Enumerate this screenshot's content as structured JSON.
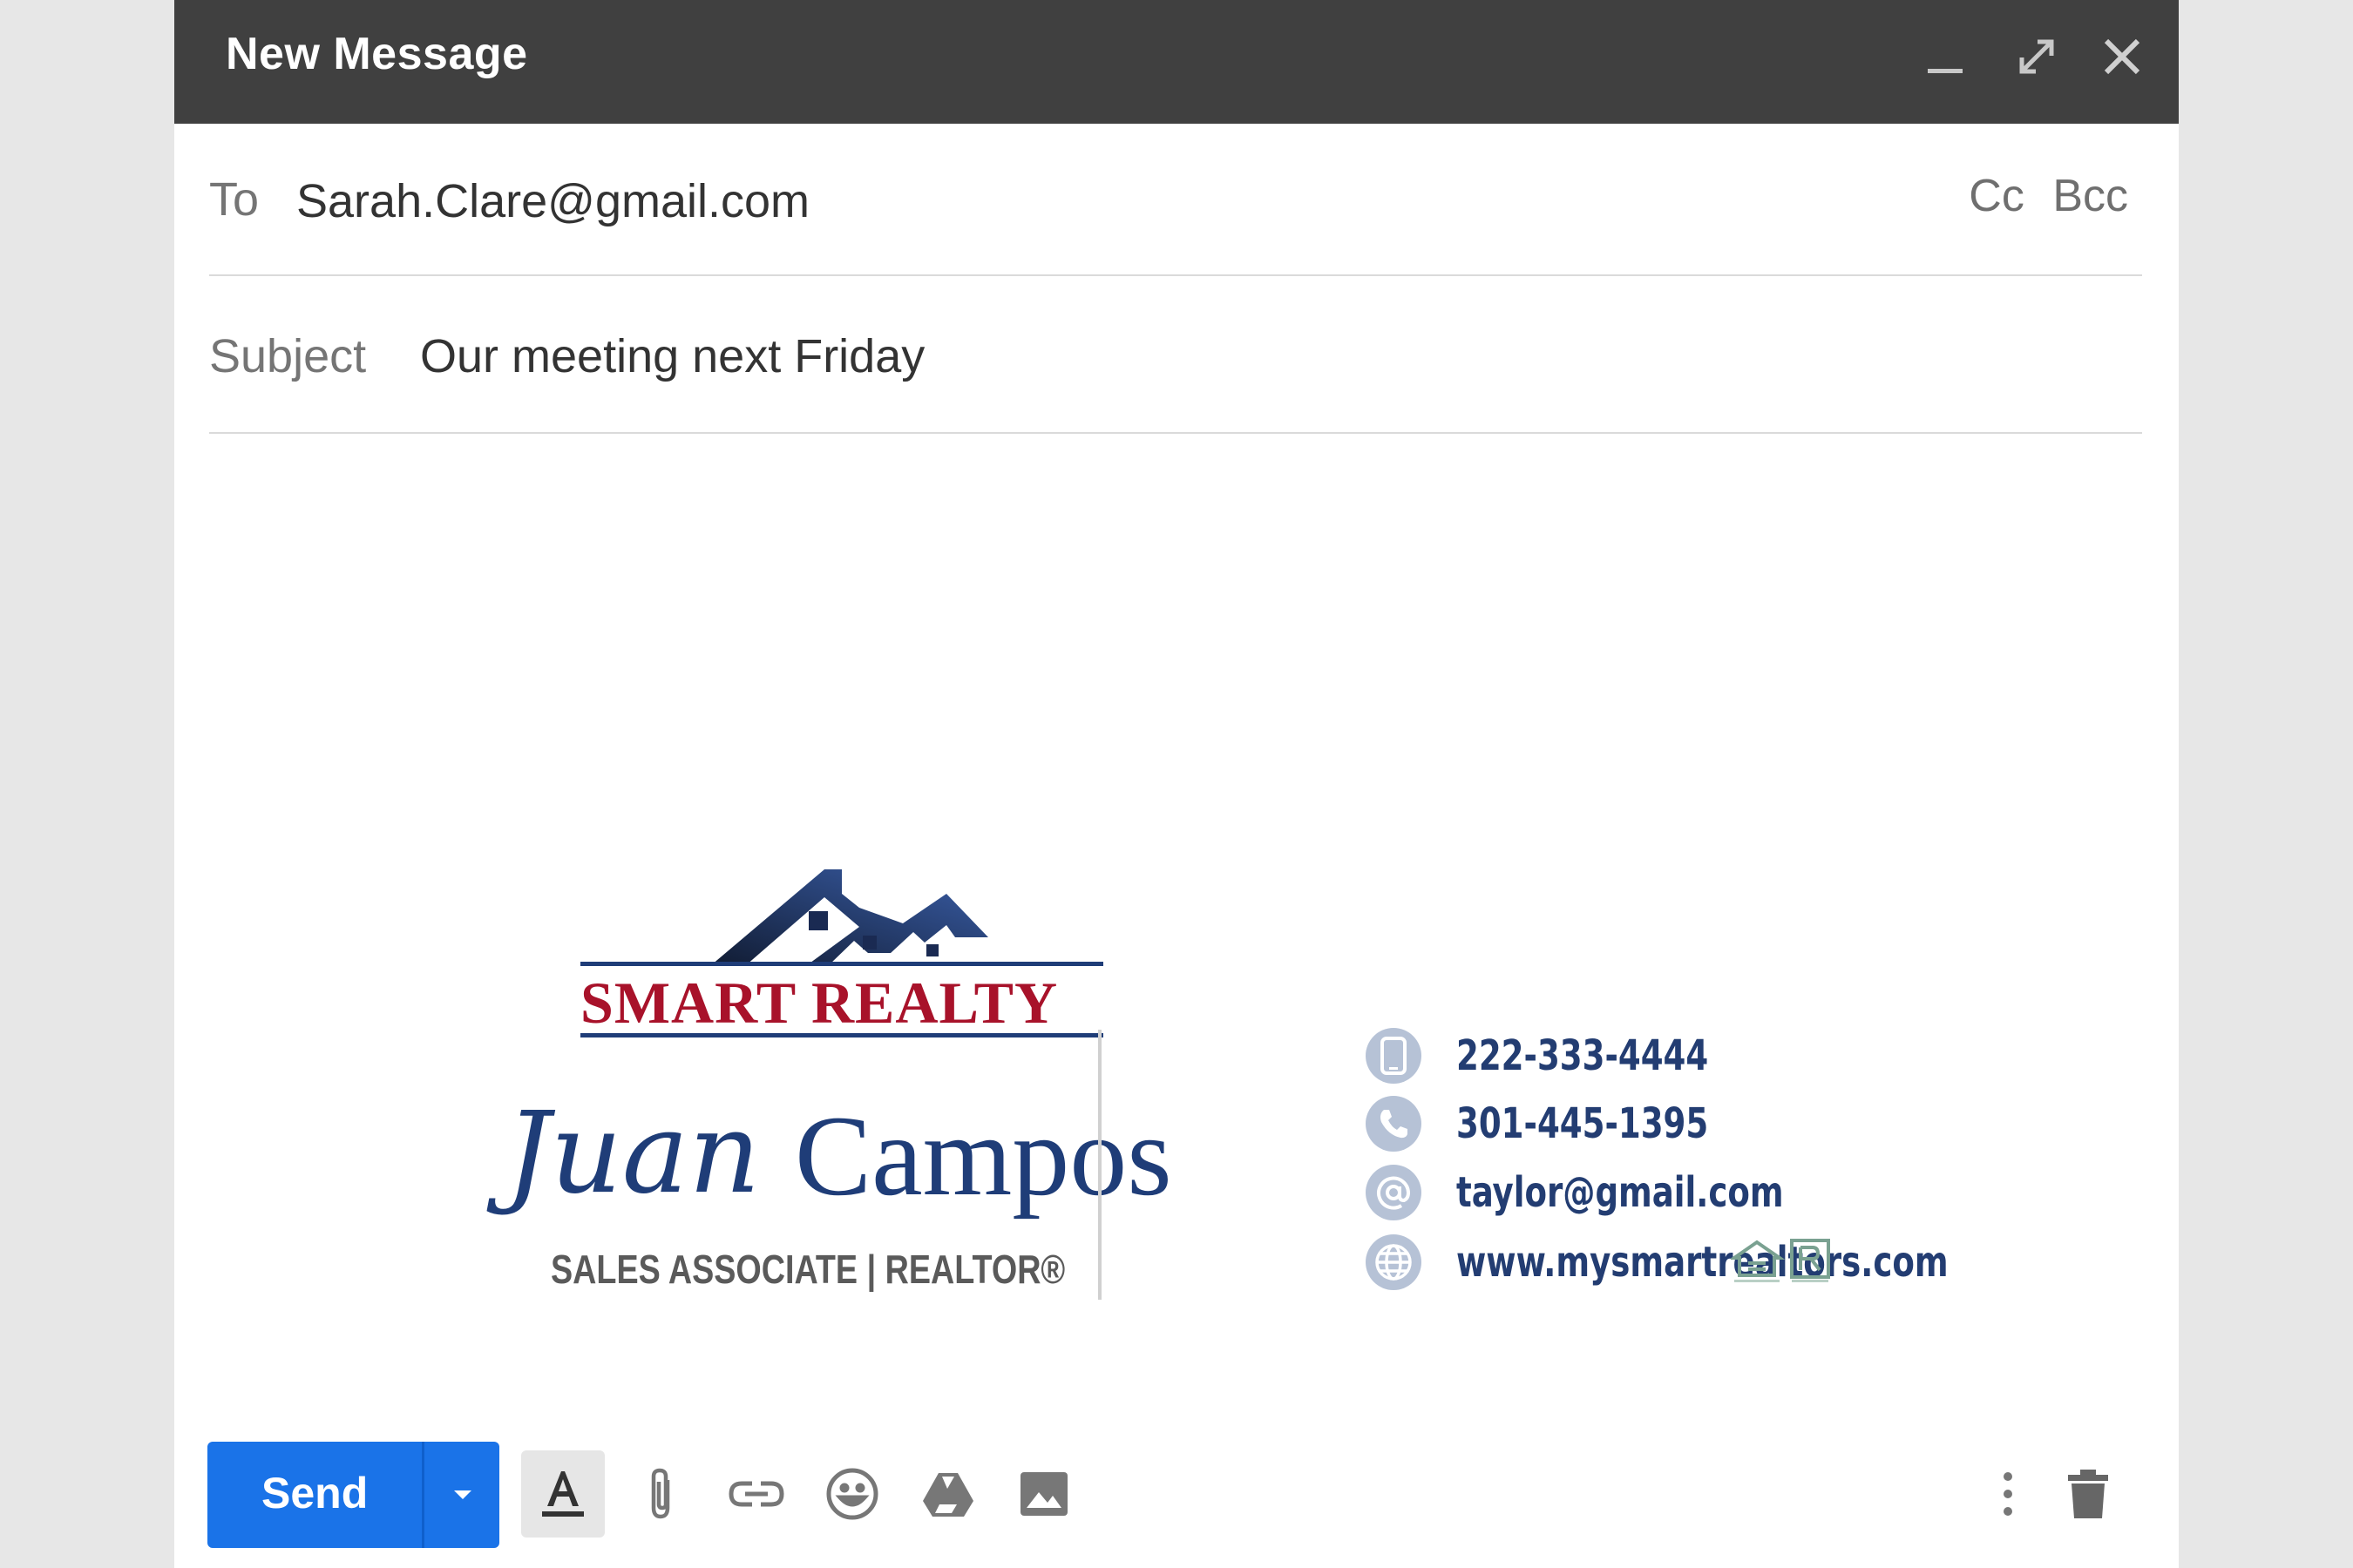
{
  "window": {
    "title": "New Message"
  },
  "compose": {
    "to_label": "To",
    "to_value": "Sarah.Clare@gmail.com",
    "cc_label": "Cc",
    "bcc_label": "Bcc",
    "subject_label": "Subject",
    "subject_value": "Our meeting next Friday"
  },
  "signature": {
    "brand": "SMART REALTY",
    "first_name": "Juan",
    "last_name": "Campos",
    "role": "SALES ASSOCIATE | REALTOR®",
    "contacts": [
      {
        "icon": "mobile-phone-icon",
        "text": "222-333-4444"
      },
      {
        "icon": "phone-icon",
        "text": "301-445-1395"
      },
      {
        "icon": "at-sign-icon",
        "text": "taylor@gmail.com"
      },
      {
        "icon": "globe-icon",
        "text": "www.mysmartrealtors.com"
      }
    ],
    "colors": {
      "brand_red": "#a8122a",
      "navy": "#1f3d78"
    }
  },
  "toolbar": {
    "send_label": "Send",
    "icons": [
      "text-format-icon",
      "attach-icon",
      "link-icon",
      "emoji-icon",
      "drive-icon",
      "photo-icon",
      "more-options-icon",
      "trash-icon"
    ]
  },
  "colors": {
    "titlebar": "#404040",
    "send": "#1a73e8"
  }
}
